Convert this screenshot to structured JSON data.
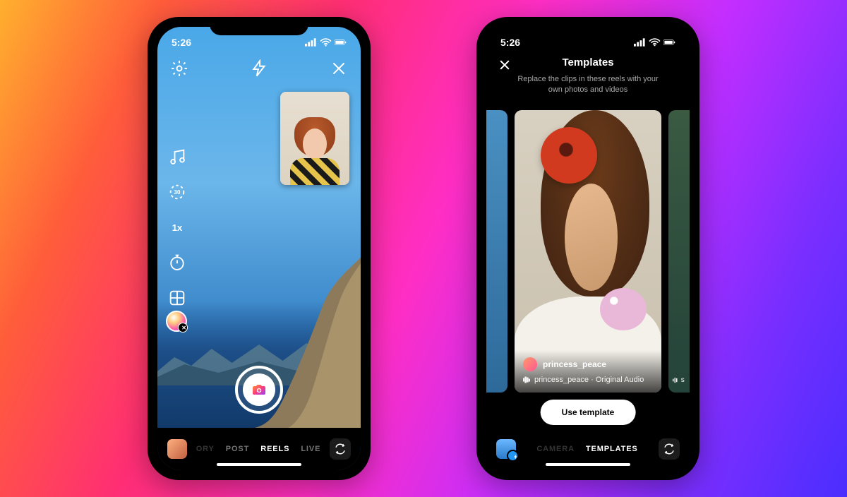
{
  "status": {
    "time": "5:26"
  },
  "phone1": {
    "tools": {
      "speed_label": "1x",
      "duration_label": "30"
    },
    "modes": {
      "story": "ORY",
      "post": "POST",
      "reels": "REELS",
      "live": "LIVE"
    },
    "selected_mode": "REELS"
  },
  "phone2": {
    "title": "Templates",
    "subtitle": "Replace the clips in these reels with your own photos and videos",
    "template": {
      "author": "princess_peace",
      "audio": "princess_peace · Original Audio"
    },
    "next_template_audio_prefix": "s",
    "use_button": "Use template",
    "modes": {
      "camera": "CAMERA",
      "templates": "TEMPLATES"
    },
    "selected_mode": "TEMPLATES"
  }
}
